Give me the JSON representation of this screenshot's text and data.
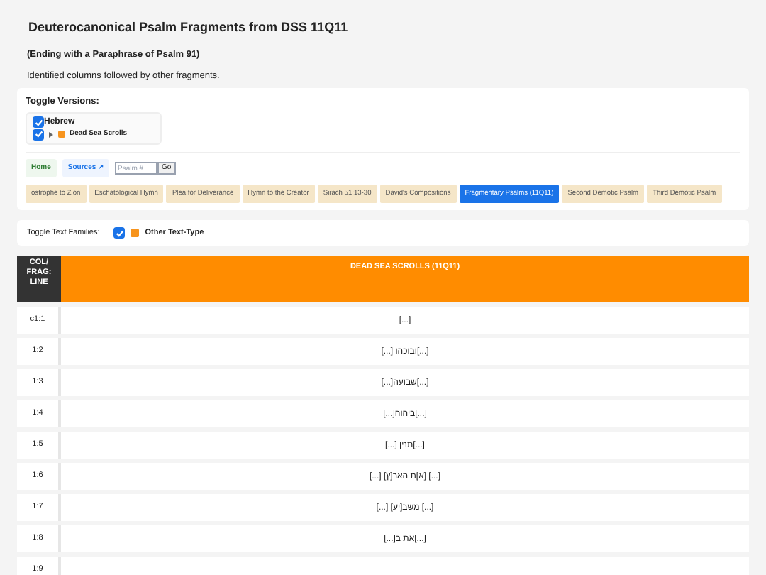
{
  "title": "Deuterocanonical Psalm Fragments from DSS 11Q11",
  "subtitle": "(Ending with a Paraphrase of Psalm 91)",
  "intro": "Identified columns followed by other fragments.",
  "versions": {
    "heading": "Toggle Versions:",
    "groups": [
      {
        "label": "Hebrew",
        "checked": true,
        "children": [
          {
            "label": "Dead Sea Scrolls",
            "checked": true,
            "expanded": false,
            "color": "#f7941d"
          }
        ]
      }
    ]
  },
  "nav": {
    "home": "Home",
    "sources": "Sources ↗",
    "search": {
      "placeholder": "Psalm #"
    },
    "go": "Go"
  },
  "tabs": [
    {
      "label": "ostrophe to Zion",
      "selected": false
    },
    {
      "label": "Eschatological Hymn",
      "selected": false
    },
    {
      "label": "Plea for Deliverance",
      "selected": false
    },
    {
      "label": "Hymn to the Creator",
      "selected": false
    },
    {
      "label": "Sirach 51:13-30",
      "selected": false
    },
    {
      "label": "David's Compositions",
      "selected": false
    },
    {
      "label": "Fragmentary Psalms (11Q11)",
      "selected": true
    },
    {
      "label": "Second Demotic Psalm",
      "selected": false
    },
    {
      "label": "Third Demotic Psalm",
      "selected": false
    }
  ],
  "families": {
    "label": "Toggle Text Families:",
    "items": [
      {
        "label": "Other Text-Type",
        "checked": true,
        "color": "#f7941d"
      }
    ]
  },
  "table": {
    "columns": [
      "COL/ FRAG: LINE",
      "DEAD SEA SCROLLS (11Q11)"
    ],
    "rows": [
      {
        "ref": "c1:1",
        "text": "[...]"
      },
      {
        "ref": "1:2",
        "text": "[...]ובוכהו [...]"
      },
      {
        "ref": "1:3",
        "text": "[...]שבועה[...]"
      },
      {
        "ref": "1:4",
        "text": "[...]ביהוה[...]"
      },
      {
        "ref": "1:5",
        "text": "[...]תנין [...]"
      },
      {
        "ref": "1:6",
        "text": "[...] [א]ת האר[ץ] [...]"
      },
      {
        "ref": "1:7",
        "text": "[...] משב[יע] [...]"
      },
      {
        "ref": "1:8",
        "text": "[...]את ב[...]"
      },
      {
        "ref": "1:9"
      }
    ]
  }
}
